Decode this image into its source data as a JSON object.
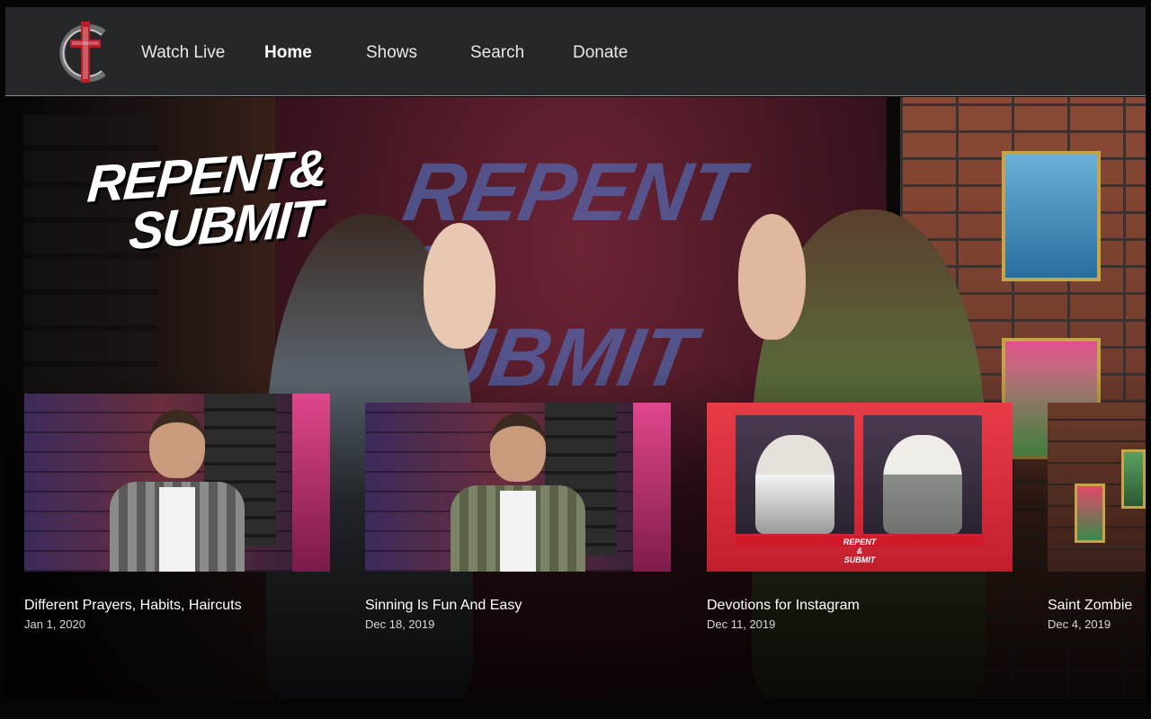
{
  "nav": {
    "items": [
      {
        "label": "Watch Live",
        "active": false
      },
      {
        "label": "Home",
        "active": true
      },
      {
        "label": "Shows",
        "active": false
      },
      {
        "label": "Search",
        "active": false
      },
      {
        "label": "Donate",
        "active": false
      }
    ]
  },
  "hero": {
    "title_line1": "REPENT&",
    "title_line2": "SUBMIT",
    "background_title": "REPENT & SUBMIT"
  },
  "episodes": [
    {
      "title": "Different Prayers, Habits, Haircuts",
      "date": "Jan 1, 2020"
    },
    {
      "title": "Sinning Is Fun And Easy",
      "date": "Dec 18, 2019"
    },
    {
      "title": "Devotions for Instagram",
      "date": "Dec 11, 2019"
    },
    {
      "title": "Saint Zombie",
      "date": "Dec 4, 2019"
    }
  ],
  "thumb3_logo": "REPENT & SUBMIT",
  "colors": {
    "navbar_bg": "#25272b",
    "logo_red": "#b3202a",
    "accent_red": "#d01a2a"
  },
  "icons": {
    "logo": "cross-c-logo-icon"
  }
}
